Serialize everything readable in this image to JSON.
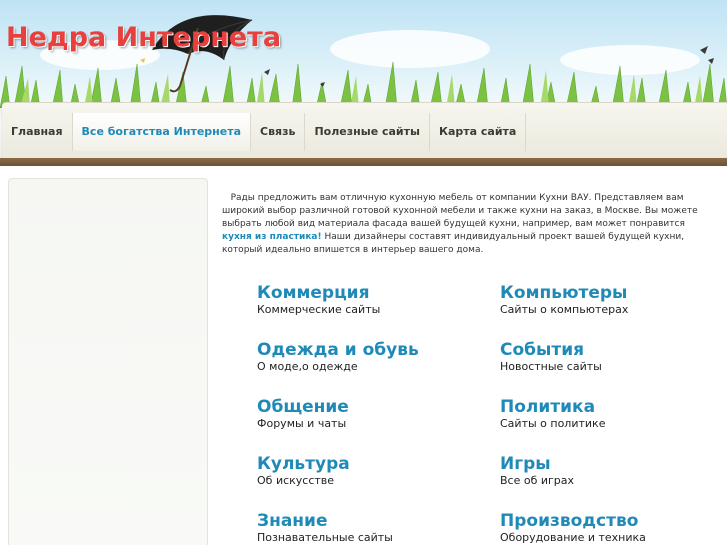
{
  "site": {
    "title": "Недра Интернета"
  },
  "nav": {
    "items": [
      {
        "label": "Главная"
      },
      {
        "label": "Все богатства Интернета"
      },
      {
        "label": "Связь"
      },
      {
        "label": "Полезные сайты"
      },
      {
        "label": "Карта сайта"
      }
    ],
    "active_index": 1
  },
  "intro": {
    "text_before": "Рады предложить вам отличную кухонную мебель от компании Кухни ВАУ. Представляем вам широкий выбор различной готовой кухонной мебели и также кухни на заказ, в Москве. Вы можете выбрать любой вид материала фасада вашей будущей кухни, например, вам может понравится ",
    "link_text": "кухня из пластика!",
    "text_after": " Наши дизайнеры составят индивидуальный проект вашей будущей кухни, который идеально впишется в интерьер вашего дома."
  },
  "categories": {
    "left": [
      {
        "title": "Коммерция",
        "desc": "Коммерческие сайты"
      },
      {
        "title": "Одежда и обувь",
        "desc": "О моде,о одежде"
      },
      {
        "title": "Общение",
        "desc": "Форумы и чаты"
      },
      {
        "title": "Культура",
        "desc": "Об искусстве"
      },
      {
        "title": "Знание",
        "desc": "Познавательные сайты"
      }
    ],
    "right": [
      {
        "title": "Компьютеры",
        "desc": "Сайты о компьютерах"
      },
      {
        "title": "События",
        "desc": "Новостные сайты"
      },
      {
        "title": "Политика",
        "desc": "Сайты о политике"
      },
      {
        "title": "Игры",
        "desc": "Все об играх"
      },
      {
        "title": "Производство",
        "desc": "Оборудование и техника"
      }
    ]
  },
  "colors": {
    "title_red": "#e8403c",
    "link_blue": "#1f8ab8",
    "nav_text": "#3b3b33"
  }
}
